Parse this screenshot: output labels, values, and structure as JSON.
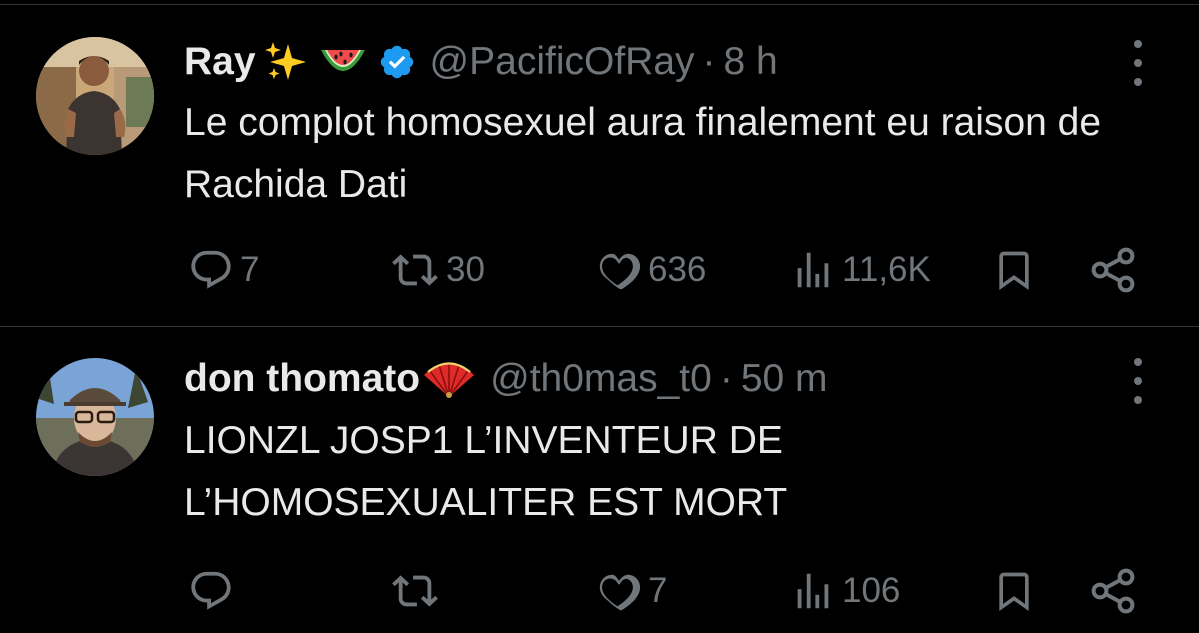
{
  "tweets": [
    {
      "display_name": "Ray",
      "emojis": [
        "sparkles-emoji",
        "watermelon-emoji"
      ],
      "verified": true,
      "handle": "@PacificOfRay",
      "separator": "·",
      "time": "8 h",
      "text": "Le complot homosexuel aura finalement eu raison de Rachida Dati",
      "replies": "7",
      "retweets": "30",
      "likes": "636",
      "views": "11,6K"
    },
    {
      "display_name": "don thomato",
      "emojis": [
        "folding-fan-emoji"
      ],
      "verified": false,
      "handle": "@th0mas_t0",
      "separator": "·",
      "time": "50 m",
      "text": "LIONZL JOSP1 L’INVENTEUR DE L’HOMOSEXUALITER EST MORT",
      "replies": "",
      "retweets": "",
      "likes": "7",
      "views": "106"
    }
  ],
  "colors": {
    "background": "#000000",
    "text": "#e7e9ea",
    "secondary": "#71767b",
    "divider": "#2f3336",
    "verified": "#1d9bf0"
  }
}
